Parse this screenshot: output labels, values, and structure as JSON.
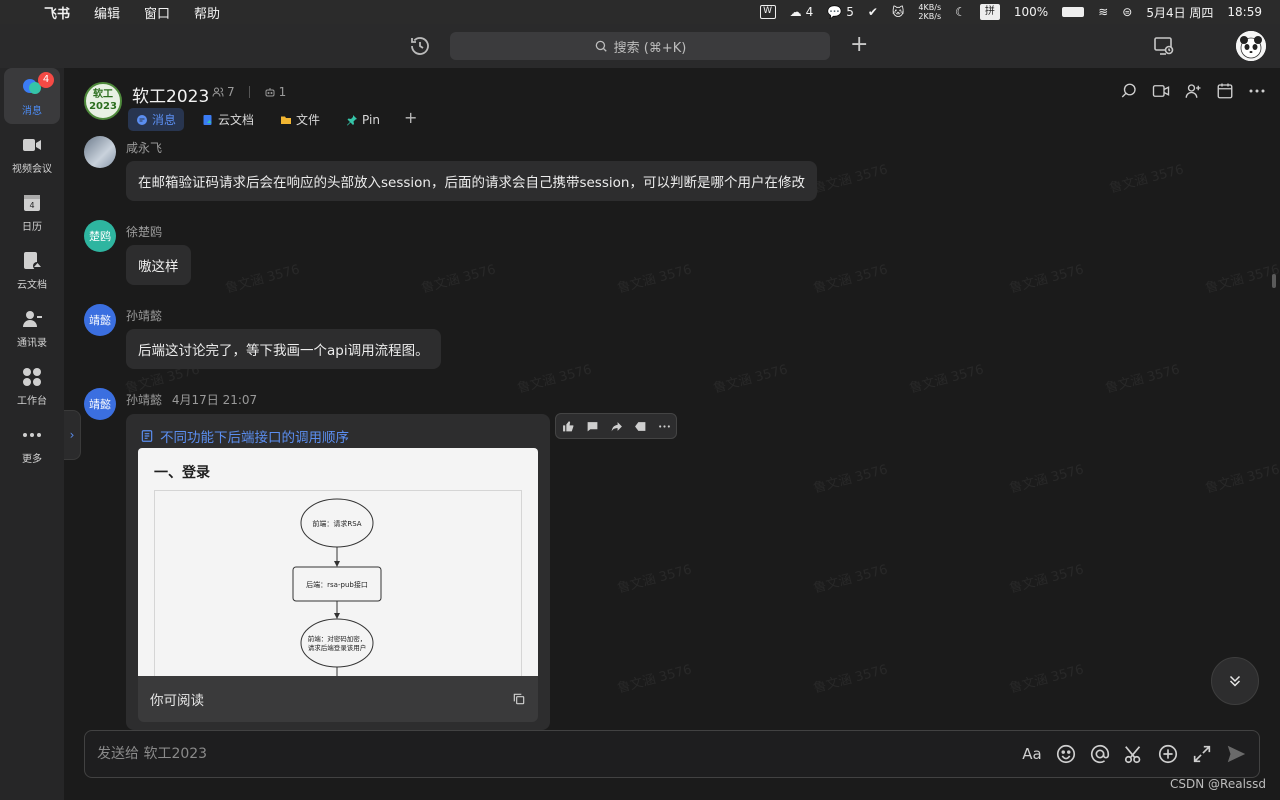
{
  "menubar": {
    "app_name": "飞书",
    "menus": [
      "编辑",
      "窗口",
      "帮助"
    ],
    "tray": {
      "wps_count": "4",
      "wechat_count": "5",
      "net_up": "4KB/s",
      "net_down": "2KB/s",
      "input_method": "拼",
      "battery": "100%",
      "date": "5月4日 周四",
      "time": "18:59"
    }
  },
  "topbar": {
    "search_placeholder": "搜索 (⌘+K)"
  },
  "sidebar": {
    "items": [
      {
        "label": "消息",
        "icon": "chat-bubble-icon",
        "badge": "4",
        "active": true
      },
      {
        "label": "视频会议",
        "icon": "video-camera-icon"
      },
      {
        "label": "日历",
        "icon": "calendar-icon",
        "day": "4"
      },
      {
        "label": "云文档",
        "icon": "cloud-doc-icon"
      },
      {
        "label": "通讯录",
        "icon": "contacts-icon"
      },
      {
        "label": "工作台",
        "icon": "workspace-grid-icon"
      },
      {
        "label": "更多",
        "icon": "more-dots-icon"
      }
    ]
  },
  "chat": {
    "group_name": "软工2023",
    "group_avatar_text": "软工2023",
    "member_count": "7",
    "bot_count": "1",
    "tabs": [
      {
        "label": "消息",
        "active": true
      },
      {
        "label": "云文档"
      },
      {
        "label": "文件"
      },
      {
        "label": "Pin"
      }
    ],
    "watermark": "鲁文涵 3576",
    "messages": [
      {
        "sender": "咸永飞",
        "avatar": "photo",
        "text": "在邮箱验证码请求后会在响应的头部放入session，后面的请求会自己携带session，可以判断是哪个用户在修改"
      },
      {
        "sender": "徐楚鸥",
        "avatar_text": "楚鸥",
        "avatar_color": "#2eb5a0",
        "text": "嗷这样"
      },
      {
        "sender": "孙靖懿",
        "avatar_text": "靖懿",
        "avatar_color": "#3b6fe0",
        "text": "后端这讨论完了，等下我画一个api调用流程图。"
      },
      {
        "sender": "孙靖懿",
        "timestamp": "4月17日 21:07",
        "avatar_text": "靖懿",
        "avatar_color": "#3b6fe0"
      }
    ],
    "doc_card": {
      "title": "不同功能下后端接口的调用顺序",
      "heading": "一、登录",
      "flow_nodes": [
        "前端：请求RSA",
        "后端：rsa-pub接口",
        "前端：对密码加密，",
        "请求后端登录该用户"
      ],
      "permission": "你可阅读"
    },
    "composer_placeholder": "发送给 软工2023"
  },
  "footer_credit": "CSDN @Realssd"
}
